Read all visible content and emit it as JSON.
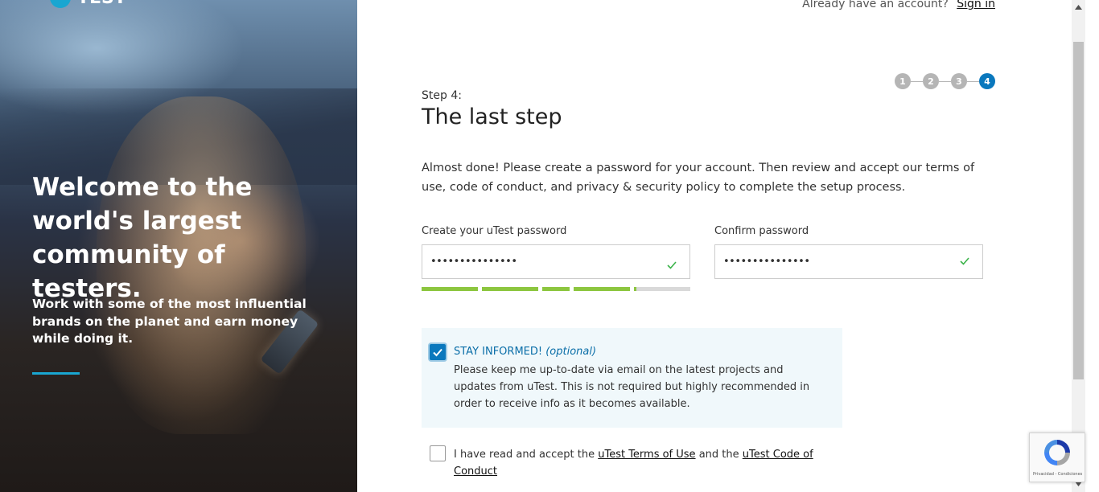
{
  "brand": {
    "logo_text": "TEST"
  },
  "hero": {
    "heading": "Welcome to the world's largest community of testers.",
    "subtext": "Work with some of the most influential brands on the planet and earn money while doing it."
  },
  "topbar": {
    "prompt": "Already have an account?",
    "signin_label": "Sign in"
  },
  "stepper": {
    "steps": [
      "1",
      "2",
      "3",
      "4"
    ],
    "active": 4
  },
  "form": {
    "step_label": "Step 4:",
    "title": "The last step",
    "intro": "Almost done! Please create a password for your account. Then review and accept our terms of use, code of conduct, and privacy & security policy to complete the setup process.",
    "password": {
      "label": "Create your uTest password",
      "value": "•••••••••••••••"
    },
    "confirm": {
      "label": "Confirm password",
      "value": "•••••••••••••••"
    },
    "strength_fraction": 0.8,
    "optin": {
      "title": "STAY INFORMED!",
      "optional": "(optional)",
      "body": "Please keep me up-to-date via email on the latest projects and updates from uTest. This is not required but highly recommended in order to receive info as it becomes available.",
      "checked": true
    },
    "terms": {
      "prefix": "I have read and accept the",
      "terms_link": "uTest Terms of Use",
      "middle": "and the",
      "code_link": "uTest Code of Conduct",
      "checked": false
    }
  },
  "recaptcha": {
    "footer": "Privacidad - Condiciones"
  },
  "colors": {
    "accent": "#0a78bd",
    "strength": "#8cc63f",
    "optin_bg": "#f0f8fb"
  }
}
